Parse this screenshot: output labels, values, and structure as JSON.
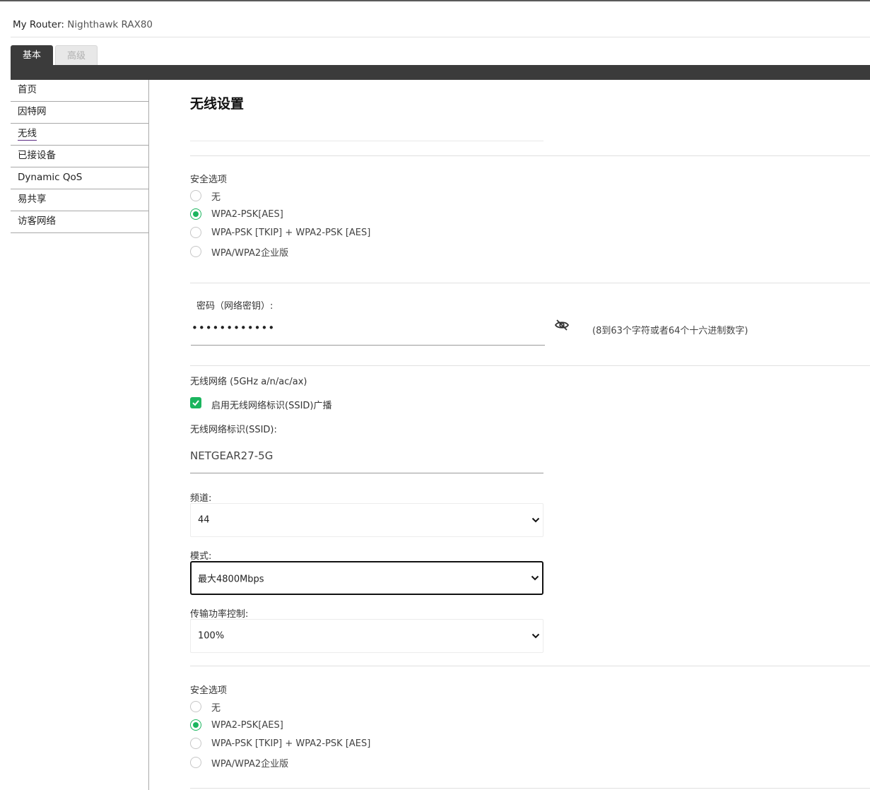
{
  "header": {
    "router_label": "My Router:",
    "router_name": "Nighthawk RAX80"
  },
  "tabs": {
    "basic": "基本",
    "advanced": "高级"
  },
  "sidebar": {
    "items": [
      {
        "label": "首页"
      },
      {
        "label": "因特网"
      },
      {
        "label": "无线",
        "active": true
      },
      {
        "label": "已接设备"
      },
      {
        "label": "Dynamic QoS"
      },
      {
        "label": "易共享"
      },
      {
        "label": "访客网络"
      }
    ]
  },
  "main": {
    "title": "无线设置",
    "security_24": {
      "label": "安全选项",
      "options": [
        "无",
        "WPA2-PSK[AES]",
        "WPA-PSK [TKIP] + WPA2-PSK [AES]",
        "WPA/WPA2企业版"
      ],
      "selected": "WPA2-PSK[AES]"
    },
    "password": {
      "label": "密码（网络密钥）:",
      "value": "••••••••••••",
      "hint": "(8到63个字符或者64个十六进制数字)"
    },
    "wireless_5g": {
      "section_label": "无线网络 (5GHz a/n/ac/ax)",
      "ssid_broadcast_label": "启用无线网络标识(SSID)广播",
      "ssid_broadcast_checked": true,
      "ssid_label": "无线网络标识(SSID):",
      "ssid_value": "NETGEAR27-5G",
      "channel_label": "频道:",
      "channel_value": "44",
      "mode_label": "模式:",
      "mode_value": "最大4800Mbps",
      "tx_power_label": "传输功率控制:",
      "tx_power_value": "100%"
    },
    "security_5g": {
      "label": "安全选项",
      "options": [
        "无",
        "WPA2-PSK[AES]",
        "WPA-PSK [TKIP] + WPA2-PSK [AES]",
        "WPA/WPA2企业版"
      ],
      "selected": "WPA2-PSK[AES]"
    }
  },
  "colors": {
    "accent_green": "#1bb55e",
    "tab_dark": "#3b3b3b",
    "active_underline": "#5a2a82"
  },
  "icons": {
    "password_toggle": "eye-slash-icon",
    "select_arrow": "chevron-down-icon",
    "checkbox": "checkmark-icon"
  }
}
